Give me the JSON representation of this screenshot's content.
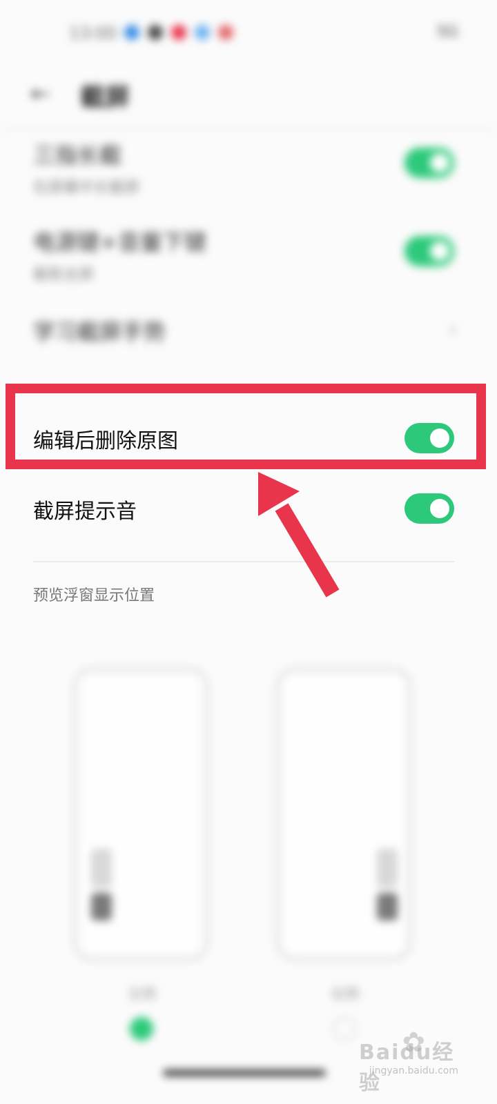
{
  "status_bar": {
    "time": "13:00",
    "dot_colors": [
      "#3a8ee6",
      "#4a4a4a",
      "#e8354b",
      "#6fb3f2",
      "#e26a6a"
    ],
    "right_text": "5G"
  },
  "header": {
    "back_icon": "back-arrow-icon",
    "title": "截屏"
  },
  "settings_blurred": [
    {
      "title": "三指长截",
      "subtitle": "在屏幕中长截屏",
      "toggle_on": true
    },
    {
      "title": "电源键+音量下键",
      "subtitle": "截取全屏",
      "toggle_on": true
    },
    {
      "title": "学习截屏手势",
      "chevron": "chevron-right-icon"
    }
  ],
  "settings": [
    {
      "label": "编辑后删除原图",
      "toggle_on": true
    },
    {
      "label": "截屏提示音",
      "toggle_on": true
    }
  ],
  "section_label": "预览浮窗显示位置",
  "preview_options": [
    {
      "caption": "左侧",
      "selected": true
    },
    {
      "caption": "右侧",
      "selected": false
    }
  ],
  "colors": {
    "accent": "#2dc97b",
    "highlight": "#e8354b"
  },
  "watermark": {
    "logo": "Baidu经验",
    "url": "jingyan.baidu.com"
  }
}
